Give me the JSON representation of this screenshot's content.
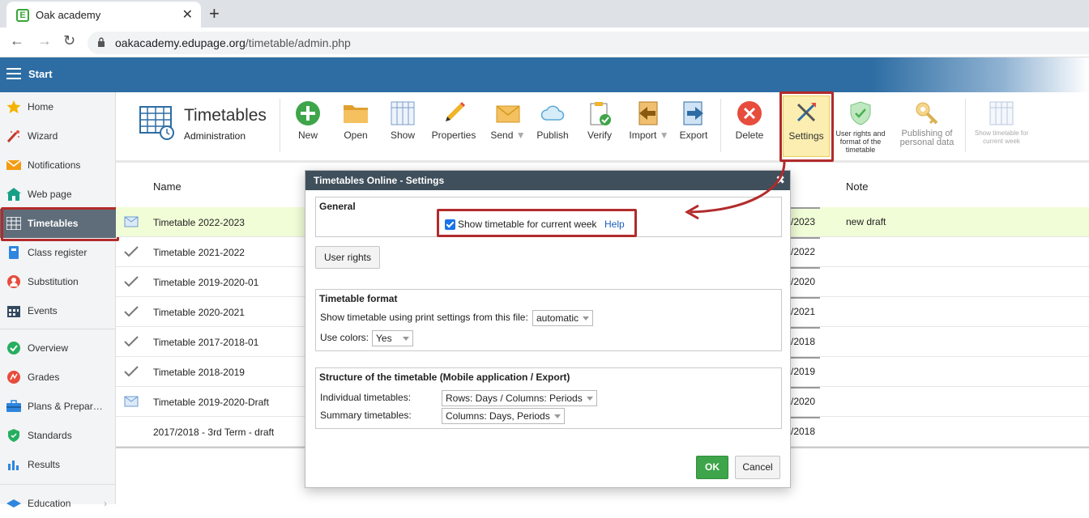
{
  "browser": {
    "tab_title": "Oak academy",
    "url_host": "oakacademy.edupage.org",
    "url_path": "/timetable/admin.php"
  },
  "app": {
    "start_label": "Start"
  },
  "sidebar": {
    "items": [
      {
        "label": "Home",
        "icon": "star-icon"
      },
      {
        "label": "Wizard",
        "icon": "wand-icon"
      },
      {
        "label": "Notifications",
        "icon": "envelope-icon"
      },
      {
        "label": "Web page",
        "icon": "house-icon"
      },
      {
        "label": "Timetables",
        "icon": "grid-icon",
        "active": true
      },
      {
        "label": "Class register",
        "icon": "book-icon"
      },
      {
        "label": "Substitution",
        "icon": "person-icon"
      },
      {
        "label": "Events",
        "icon": "calendar-icon"
      },
      {
        "label": "Overview",
        "icon": "check-circle-icon"
      },
      {
        "label": "Grades",
        "icon": "grades-icon"
      },
      {
        "label": "Plans & Prepar…",
        "icon": "briefcase-icon"
      },
      {
        "label": "Standards",
        "icon": "shield-icon"
      },
      {
        "label": "Results",
        "icon": "bar-chart-icon"
      },
      {
        "label": "Education",
        "icon": "education-icon"
      }
    ]
  },
  "toolbar": {
    "title": "Timetables",
    "subtitle": "Administration",
    "buttons": {
      "new": "New",
      "open": "Open",
      "show": "Show",
      "properties": "Properties",
      "send": "Send",
      "publish": "Publish",
      "verify": "Verify",
      "import": "Import",
      "export": "Export",
      "delete": "Delete",
      "settings": "Settings",
      "user_rights": "User rights and format of the timetable",
      "publishing": "Publishing of personal data",
      "show_current": "Show timetable for current week"
    }
  },
  "table": {
    "headers": {
      "name": "Name",
      "note": "Note"
    },
    "rows": [
      {
        "name": "Timetable 2022-2023",
        "year": "/2023",
        "note": "new draft",
        "icon": "envelope-icon",
        "selected": true
      },
      {
        "name": "Timetable 2021-2022",
        "year": "/2022",
        "note": "",
        "icon": "checkmark-icon"
      },
      {
        "name": "Timetable 2019-2020-01",
        "year": "/2020",
        "note": "",
        "icon": "checkmark-icon"
      },
      {
        "name": "Timetable 2020-2021",
        "year": "/2021",
        "note": "",
        "icon": "checkmark-icon"
      },
      {
        "name": "Timetable 2017-2018-01",
        "year": "/2018",
        "note": "",
        "icon": "checkmark-icon"
      },
      {
        "name": "Timetable 2018-2019",
        "year": "/2019",
        "note": "",
        "icon": "checkmark-icon"
      },
      {
        "name": "Timetable 2019-2020-Draft",
        "year": "/2020",
        "note": "",
        "icon": "envelope-icon"
      },
      {
        "name": "2017/2018 - 3rd Term - draft",
        "year": "/2018",
        "note": "",
        "icon": ""
      }
    ]
  },
  "dialog": {
    "title": "Timetables Online - Settings",
    "general": {
      "legend": "General",
      "checkbox_label": "Show timetable for current week",
      "checked": true,
      "help": "Help"
    },
    "user_rights_button": "User rights",
    "format": {
      "legend": "Timetable format",
      "print_label": "Show timetable using print settings from this file:",
      "print_value": "automatic",
      "colors_label": "Use colors:",
      "colors_value": "Yes"
    },
    "structure": {
      "legend": "Structure of the timetable (Mobile application / Export)",
      "individual_label": "Individual timetables:",
      "individual_value": "Rows: Days / Columns: Periods",
      "summary_label": "Summary timetables:",
      "summary_value": "Columns: Days, Periods"
    },
    "ok": "OK",
    "cancel": "Cancel"
  },
  "colors": {
    "header_blue": "#2d6da3",
    "highlight_red": "#b22b2b",
    "ok_green": "#3ea54a",
    "selected_row": "#f1fdd7"
  }
}
